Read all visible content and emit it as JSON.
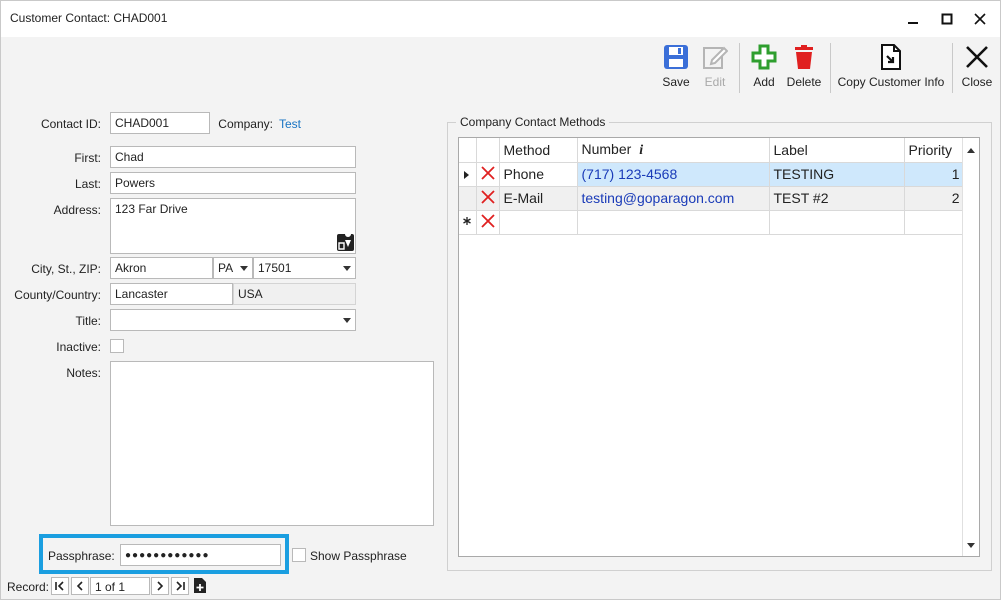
{
  "window": {
    "title": "Customer Contact: CHAD001"
  },
  "toolbar": {
    "save": "Save",
    "edit": "Edit",
    "add": "Add",
    "delete": "Delete",
    "copy": "Copy Customer Info",
    "close": "Close"
  },
  "form": {
    "contact_id_label": "Contact ID:",
    "contact_id": "CHAD001",
    "company_label": "Company:",
    "company": "Test",
    "first_label": "First:",
    "first": "Chad",
    "last_label": "Last:",
    "last": "Powers",
    "address_label": "Address:",
    "address": "123 Far Drive",
    "city_label": "City, St., ZIP:",
    "city": "Akron",
    "state": "PA",
    "zip": "17501",
    "county_label": "County/Country:",
    "county": "Lancaster",
    "country": "USA",
    "title_label": "Title:",
    "title_value": "",
    "inactive_label": "Inactive:",
    "notes_label": "Notes:",
    "notes": "",
    "passphrase_label": "Passphrase:",
    "passphrase": "●●●●●●●●●●●●",
    "show_passphrase": "Show Passphrase"
  },
  "methods": {
    "group_title": "Company Contact Methods",
    "columns": [
      "Method",
      "Number",
      "Label",
      "Priority"
    ],
    "number_info": "i",
    "rows": [
      {
        "method": "Phone",
        "number": "(717) 123-4568",
        "label": "TESTING",
        "priority": "1"
      },
      {
        "method": "E-Mail",
        "number": "testing@goparagon.com",
        "label": "TEST #2",
        "priority": "2"
      }
    ]
  },
  "record": {
    "label": "Record:",
    "position": "1 of 1"
  },
  "colors": {
    "accent_blue": "#1a9ee0",
    "save_blue": "#3b6fd8",
    "add_green": "#2e9e2e",
    "delete_red": "#e02020",
    "delete_x": "#e02020"
  }
}
